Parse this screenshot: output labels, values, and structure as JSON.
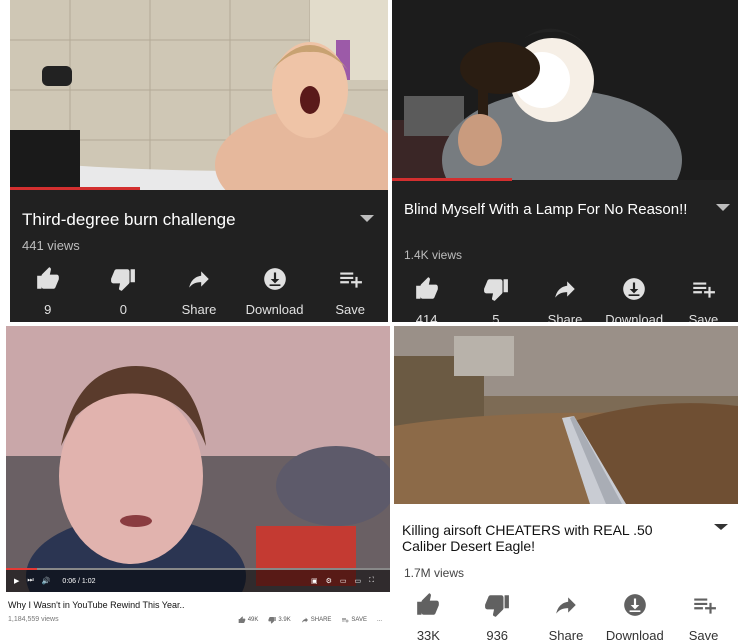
{
  "panels": [
    {
      "title": "Third-degree burn challenge",
      "views": "441 views",
      "actions": [
        {
          "icon": "thumbs-up-icon",
          "label": "9"
        },
        {
          "icon": "thumbs-down-icon",
          "label": "0"
        },
        {
          "icon": "share-icon",
          "label": "Share"
        },
        {
          "icon": "download-icon",
          "label": "Download"
        },
        {
          "icon": "save-playlist-icon",
          "label": "Save"
        }
      ]
    },
    {
      "title": "Blind Myself With a Lamp For No Reason!!",
      "views": "1.4K views",
      "actions": [
        {
          "icon": "thumbs-up-icon",
          "label": "414"
        },
        {
          "icon": "thumbs-down-icon",
          "label": "5"
        },
        {
          "icon": "share-icon",
          "label": "Share"
        },
        {
          "icon": "download-icon",
          "label": "Download"
        },
        {
          "icon": "save-playlist-icon",
          "label": "Save"
        }
      ]
    },
    {
      "title": "Why I Wasn't in YouTube Rewind This Year..",
      "views": "1,184,559 views",
      "player_time": "0:06 / 1:02",
      "actions": [
        {
          "icon": "thumbs-up-icon",
          "label": "49K"
        },
        {
          "icon": "thumbs-down-icon",
          "label": "3.9K"
        },
        {
          "icon": "share-icon",
          "label": "SHARE"
        },
        {
          "icon": "save-playlist-icon",
          "label": "SAVE"
        },
        {
          "icon": "more-icon",
          "label": "..."
        }
      ]
    },
    {
      "title": "Killing airsoft CHEATERS with REAL .50 Caliber Desert Eagle!",
      "views": "1.7M views",
      "actions": [
        {
          "icon": "thumbs-up-icon",
          "label": "33K"
        },
        {
          "icon": "thumbs-down-icon",
          "label": "936"
        },
        {
          "icon": "share-icon",
          "label": "Share"
        },
        {
          "icon": "download-icon",
          "label": "Download"
        },
        {
          "icon": "save-playlist-icon",
          "label": "Save"
        }
      ]
    }
  ],
  "colors": {
    "dark_bg": "#212121",
    "progress_red": "#d32f2f",
    "light_bg": "#ffffff"
  }
}
